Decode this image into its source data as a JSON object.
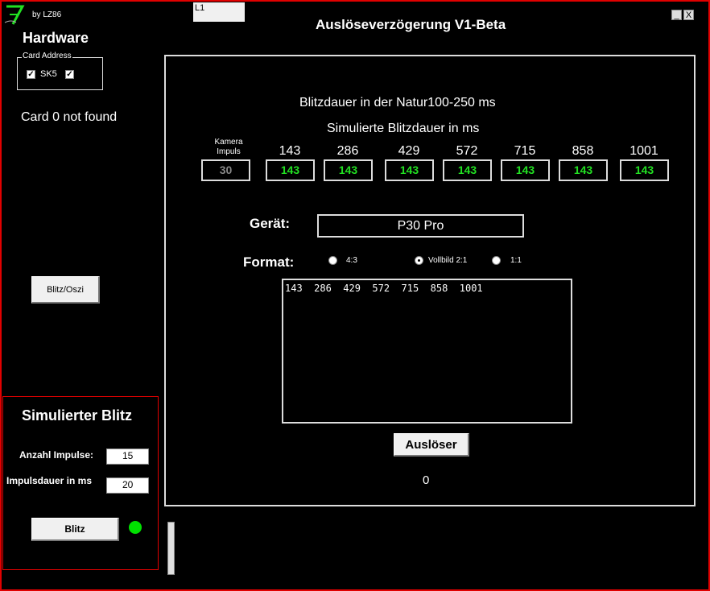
{
  "app": {
    "by": "by LZ86",
    "l1": "L1",
    "title": "Auslöseverzögerung V1-Beta",
    "minimize": "_",
    "close": "X"
  },
  "hardware": {
    "title": "Hardware",
    "card_address_label": "Card Address",
    "sk5_label": "SK5",
    "sk5_checked": true,
    "second_checked": true,
    "card_status": "Card  0 not found",
    "blitz_oszi_button": "Blitz/Oszi"
  },
  "sim": {
    "title": "Simulierter Blitz",
    "anzahl_label": "Anzahl Impulse:",
    "anzahl_value": "15",
    "dauer_label": "Impulsdauer in ms",
    "dauer_value": "20",
    "blitz_button": "Blitz",
    "led_color": "#00e000"
  },
  "main": {
    "natur_text": "Blitzdauer in der Natur100-250 ms",
    "sim_text": "Simulierte Blitzdauer in ms",
    "kamera_label_1": "Kamera",
    "kamera_label_2": "Impuls",
    "kamera_value": "30",
    "columns": [
      "143",
      "286",
      "429",
      "572",
      "715",
      "858",
      "1001"
    ],
    "values": [
      "143",
      "143",
      "143",
      "143",
      "143",
      "143",
      "143"
    ],
    "value_color": "#22e022",
    "geraet_label": "Gerät:",
    "geraet_value": "P30 Pro",
    "format_label": "Format:",
    "formats": [
      {
        "label": "4:3",
        "selected": false
      },
      {
        "label": "Vollbild 2:1",
        "selected": true
      },
      {
        "label": "1:1",
        "selected": false
      }
    ],
    "output_text": "143  286  429  572  715  858  1001",
    "ausloeser_button": "Auslöser",
    "counter": "0"
  }
}
